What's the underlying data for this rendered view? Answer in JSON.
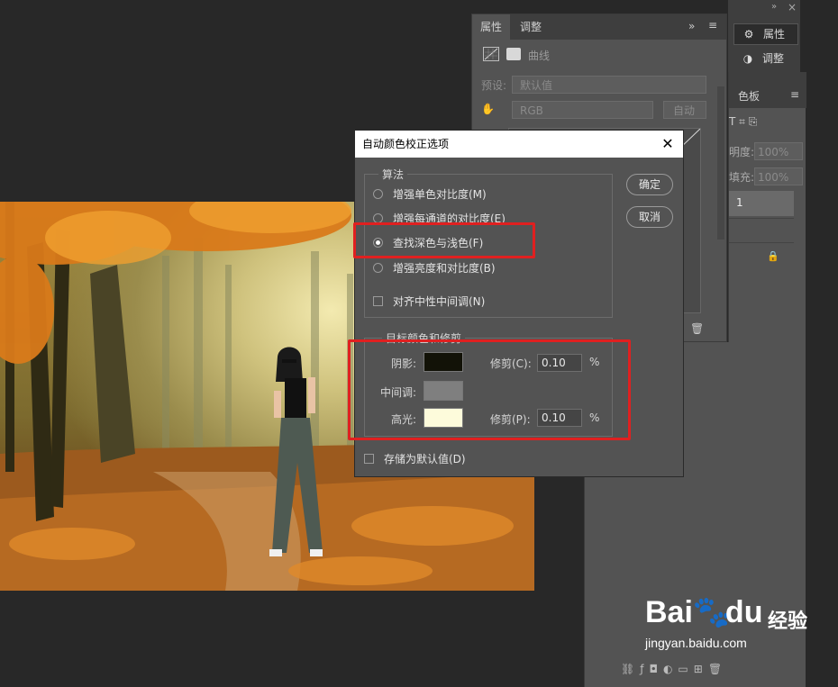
{
  "props_panel": {
    "tabs": [
      "属性",
      "调整"
    ],
    "title": "曲线",
    "preset_label": "预设:",
    "preset_value": "默认值",
    "channel_value": "RGB",
    "auto_button": "自动"
  },
  "side_tools": {
    "properties_label": "属性",
    "adjust_label": "调整"
  },
  "swatches_panel": {
    "tab_label": "色板",
    "opacity_label": "明度:",
    "opacity_value": "100%",
    "fill_label": "填充:",
    "fill_value": "100%",
    "layer_label": "1"
  },
  "dialog": {
    "title": "自动颜色校正选项",
    "algorithm_group": "算法",
    "options": [
      "增强单色对比度(M)",
      "增强每通道的对比度(E)",
      "查找深色与浅色(F)",
      "增强亮度和对比度(B)"
    ],
    "selected_option_index": 2,
    "snap_neutral": "对齐中性中间调(N)",
    "snap_neutral_checked": false,
    "ok_button": "确定",
    "cancel_button": "取消",
    "target_group": "目标颜色和修剪",
    "shadows_label": "阴影:",
    "midtones_label": "中间调:",
    "highlights_label": "高光:",
    "shadows_color": "#121207",
    "midtones_color": "#7f7f7f",
    "highlights_color": "#fdfbdb",
    "clip_shadows_label": "修剪(C):",
    "clip_shadows_value": "0.10",
    "clip_highlights_label": "修剪(P):",
    "clip_highlights_value": "0.10",
    "percent": "%",
    "save_default": "存储为默认值(D)",
    "save_default_checked": false
  },
  "highlight_color": "#e02020",
  "watermark": {
    "brand": "Bai",
    "brand2": "du",
    "suffix": "经验",
    "url": "jingyan.baidu.com"
  }
}
